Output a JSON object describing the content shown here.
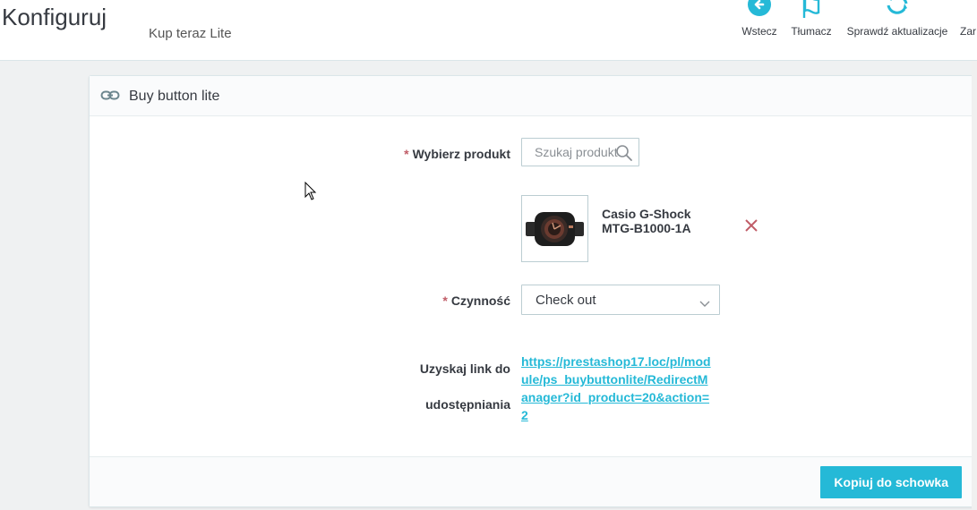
{
  "header": {
    "title": "Konfiguruj",
    "subtab": "Kup teraz Lite",
    "toolbar": [
      {
        "label": "Wstecz",
        "icon": "back-arrow-icon"
      },
      {
        "label": "Tłumacz",
        "icon": "flag-icon"
      },
      {
        "label": "Sprawdź aktualizacje",
        "icon": "refresh-icon"
      },
      {
        "label": "Zar",
        "icon": "manage-icon"
      }
    ]
  },
  "panel": {
    "title": "Buy button lite",
    "icon": "link-icon",
    "fields": {
      "product_label": "Wybierz produkt",
      "search_placeholder": "Szukaj produkt",
      "selected_product_name": "Casio G-Shock MTG-B1000-1A",
      "action_label": "Czynność",
      "action_value": "Check out",
      "link_label": "Uzyskaj link do udostępniania",
      "link_url": "https://prestashop17.loc/pl/module/ps_buybuttonlite/RedirectManager?id_product=20&action=2"
    },
    "required_mark": "*",
    "copy_button": "Kopiuj do schowka"
  },
  "colors": {
    "accent": "#25b9d7",
    "required": "#c05c67",
    "remove": "#c05c67"
  }
}
